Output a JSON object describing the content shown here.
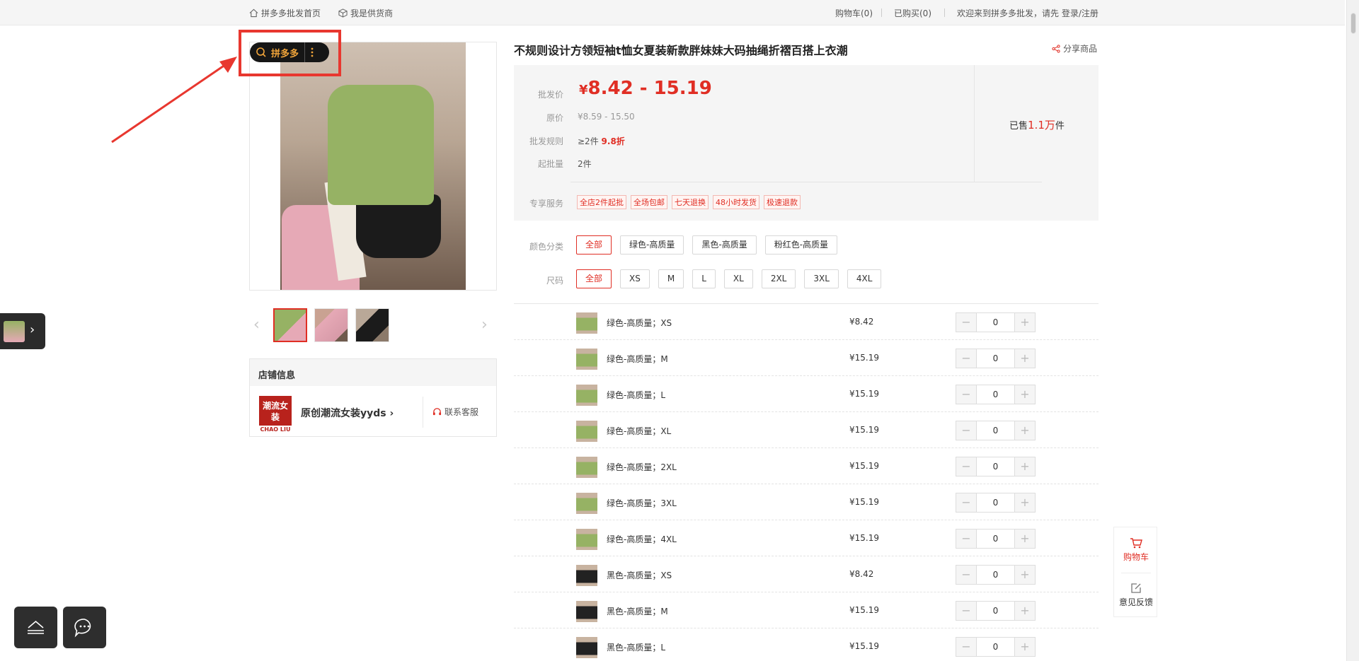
{
  "topbar": {
    "home": "拼多多批发首页",
    "supplier": "我是供货商",
    "cart": "购物车(0)",
    "bought": "已购买(0)",
    "welcome": "欢迎来到拼多多批发，请先 登录/注册"
  },
  "overlay": {
    "label": "拼多多"
  },
  "product": {
    "title": "不规则设计方领短袖t恤女夏装新款胖妹妹大码抽绳折褶百搭上衣潮",
    "share": "分享商品",
    "price_label": "批发价",
    "price_currency": "¥",
    "price_range": "8.42 - 15.19",
    "orig_label": "原价",
    "orig_value": "¥8.59 - 15.50",
    "rule_label": "批发规则",
    "rule_value": "≥2件",
    "rule_discount": "9.8折",
    "moq_label": "起批量",
    "moq_value": "2件",
    "sold_prefix": "已售",
    "sold_num": "1.1万",
    "sold_suffix": "件",
    "service_label": "专享服务",
    "services": [
      "全店2件起批",
      "全场包邮",
      "七天退换",
      "48小时发货",
      "极速退款"
    ]
  },
  "filters": {
    "color_label": "颜色分类",
    "colors": [
      "全部",
      "绿色-高质量",
      "黑色-高质量",
      "粉红色-高质量"
    ],
    "size_label": "尺码",
    "sizes": [
      "全部",
      "XS",
      "M",
      "L",
      "XL",
      "2XL",
      "3XL",
      "4XL"
    ]
  },
  "skus": [
    {
      "name": "绿色-高质量；XS",
      "price": "¥8.42",
      "qty": "0",
      "color": "#96b264"
    },
    {
      "name": "绿色-高质量；M",
      "price": "¥15.19",
      "qty": "0",
      "color": "#96b264"
    },
    {
      "name": "绿色-高质量；L",
      "price": "¥15.19",
      "qty": "0",
      "color": "#96b264"
    },
    {
      "name": "绿色-高质量；XL",
      "price": "¥15.19",
      "qty": "0",
      "color": "#96b264"
    },
    {
      "name": "绿色-高质量；2XL",
      "price": "¥15.19",
      "qty": "0",
      "color": "#96b264"
    },
    {
      "name": "绿色-高质量；3XL",
      "price": "¥15.19",
      "qty": "0",
      "color": "#96b264"
    },
    {
      "name": "绿色-高质量；4XL",
      "price": "¥15.19",
      "qty": "0",
      "color": "#96b264"
    },
    {
      "name": "黑色-高质量；XS",
      "price": "¥8.42",
      "qty": "0",
      "color": "#222222"
    },
    {
      "name": "黑色-高质量；M",
      "price": "¥15.19",
      "qty": "0",
      "color": "#222222"
    },
    {
      "name": "黑色-高质量；L",
      "price": "¥15.19",
      "qty": "0",
      "color": "#222222"
    }
  ],
  "store": {
    "header": "店铺信息",
    "logo_cn": "潮流女装",
    "logo_en": "CHAO LIU",
    "name": "原创潮流女装yyds",
    "contact": "联系客服"
  },
  "float": {
    "cart": "购物车",
    "feedback": "意见反馈"
  },
  "colors": {
    "accent": "#e02e24",
    "pdd_orange": "#f0a43a"
  }
}
